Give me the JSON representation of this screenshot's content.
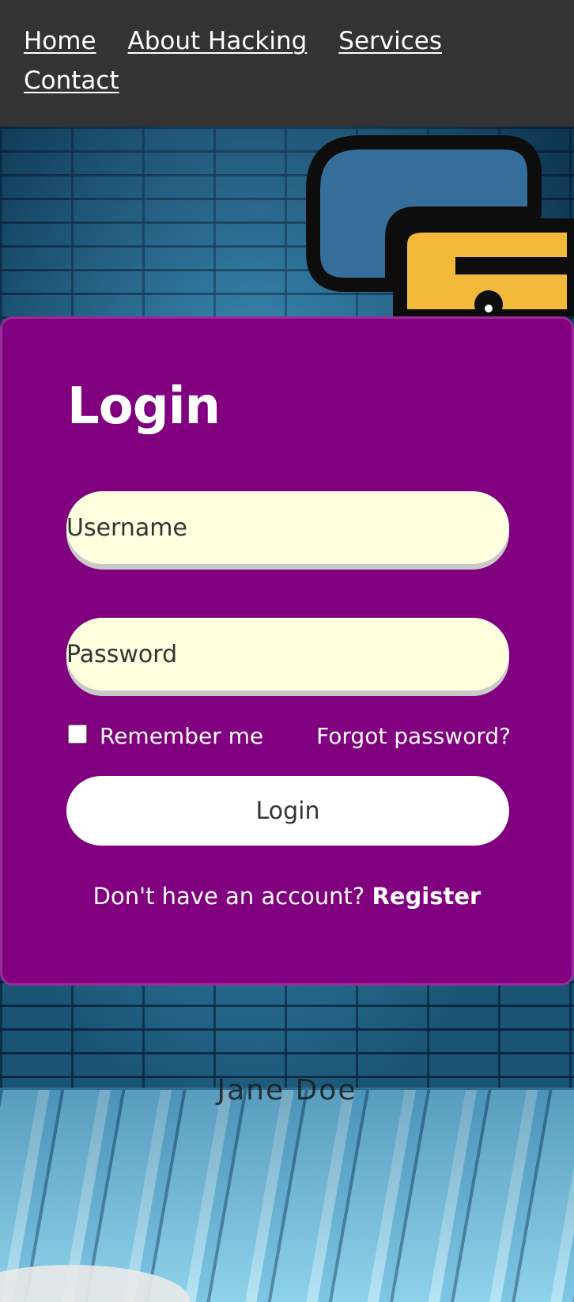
{
  "nav": {
    "links": [
      "Home",
      "About Hacking",
      "Services",
      "Contact"
    ]
  },
  "login": {
    "title": "Login",
    "username_placeholder": "Username",
    "password_placeholder": "Password",
    "remember_label": "Remember me",
    "forgot_label": "Forgot password?",
    "submit_label": "Login",
    "register_prompt": "Don't have an account?",
    "register_link": "Register"
  },
  "author": "Jane Doe",
  "colors": {
    "nav_bg": "#333333",
    "card_bg": "#800080",
    "field_bg": "#ffffe0",
    "button_bg": "#ffffff",
    "python_blue": "#356e9b",
    "python_yellow": "#f3b93a"
  }
}
